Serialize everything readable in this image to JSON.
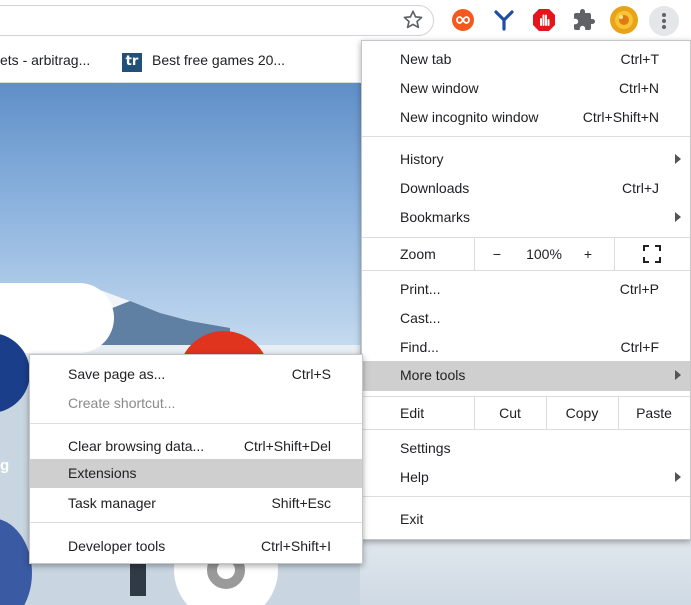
{
  "toolbar": {
    "icons": [
      "star-icon",
      "infinity-extension-icon",
      "y-extension-icon",
      "adblock-extension-icon",
      "puzzle-extensions-icon",
      "profile-avatar",
      "kebab-menu-icon"
    ],
    "colors": {
      "infinity": "#f4581c",
      "y": "#1f4fa3",
      "adblock": "#e4161b",
      "puzzle": "#5f6368"
    }
  },
  "bookmarks": [
    {
      "label": "ets - arbitrag..."
    },
    {
      "label": "Best free games 20...",
      "icon_text": "tr"
    }
  ],
  "main_menu": {
    "items": {
      "new_tab": {
        "label": "New tab",
        "shortcut": "Ctrl+T"
      },
      "new_window": {
        "label": "New window",
        "shortcut": "Ctrl+N"
      },
      "new_incognito": {
        "label": "New incognito window",
        "shortcut": "Ctrl+Shift+N"
      },
      "history": {
        "label": "History"
      },
      "downloads": {
        "label": "Downloads",
        "shortcut": "Ctrl+J"
      },
      "bookmarks": {
        "label": "Bookmarks"
      },
      "print": {
        "label": "Print...",
        "shortcut": "Ctrl+P"
      },
      "cast": {
        "label": "Cast..."
      },
      "find": {
        "label": "Find...",
        "shortcut": "Ctrl+F"
      },
      "more_tools": {
        "label": "More tools"
      },
      "settings": {
        "label": "Settings"
      },
      "help": {
        "label": "Help"
      },
      "exit": {
        "label": "Exit"
      }
    },
    "zoom": {
      "label": "Zoom",
      "minus": "−",
      "value": "100%",
      "plus": "+"
    },
    "edit": {
      "label": "Edit",
      "cut": "Cut",
      "copy": "Copy",
      "paste": "Paste"
    }
  },
  "submenu": {
    "save_page": {
      "label": "Save page as...",
      "shortcut": "Ctrl+S"
    },
    "create_shortcut": {
      "label": "Create shortcut..."
    },
    "clear_browsing": {
      "label": "Clear browsing data...",
      "shortcut": "Ctrl+Shift+Del"
    },
    "extensions": {
      "label": "Extensions"
    },
    "task_manager": {
      "label": "Task manager",
      "shortcut": "Shift+Esc"
    },
    "developer_tools": {
      "label": "Developer tools",
      "shortcut": "Ctrl+Shift+I"
    }
  },
  "background": {
    "partial_label": "g"
  }
}
